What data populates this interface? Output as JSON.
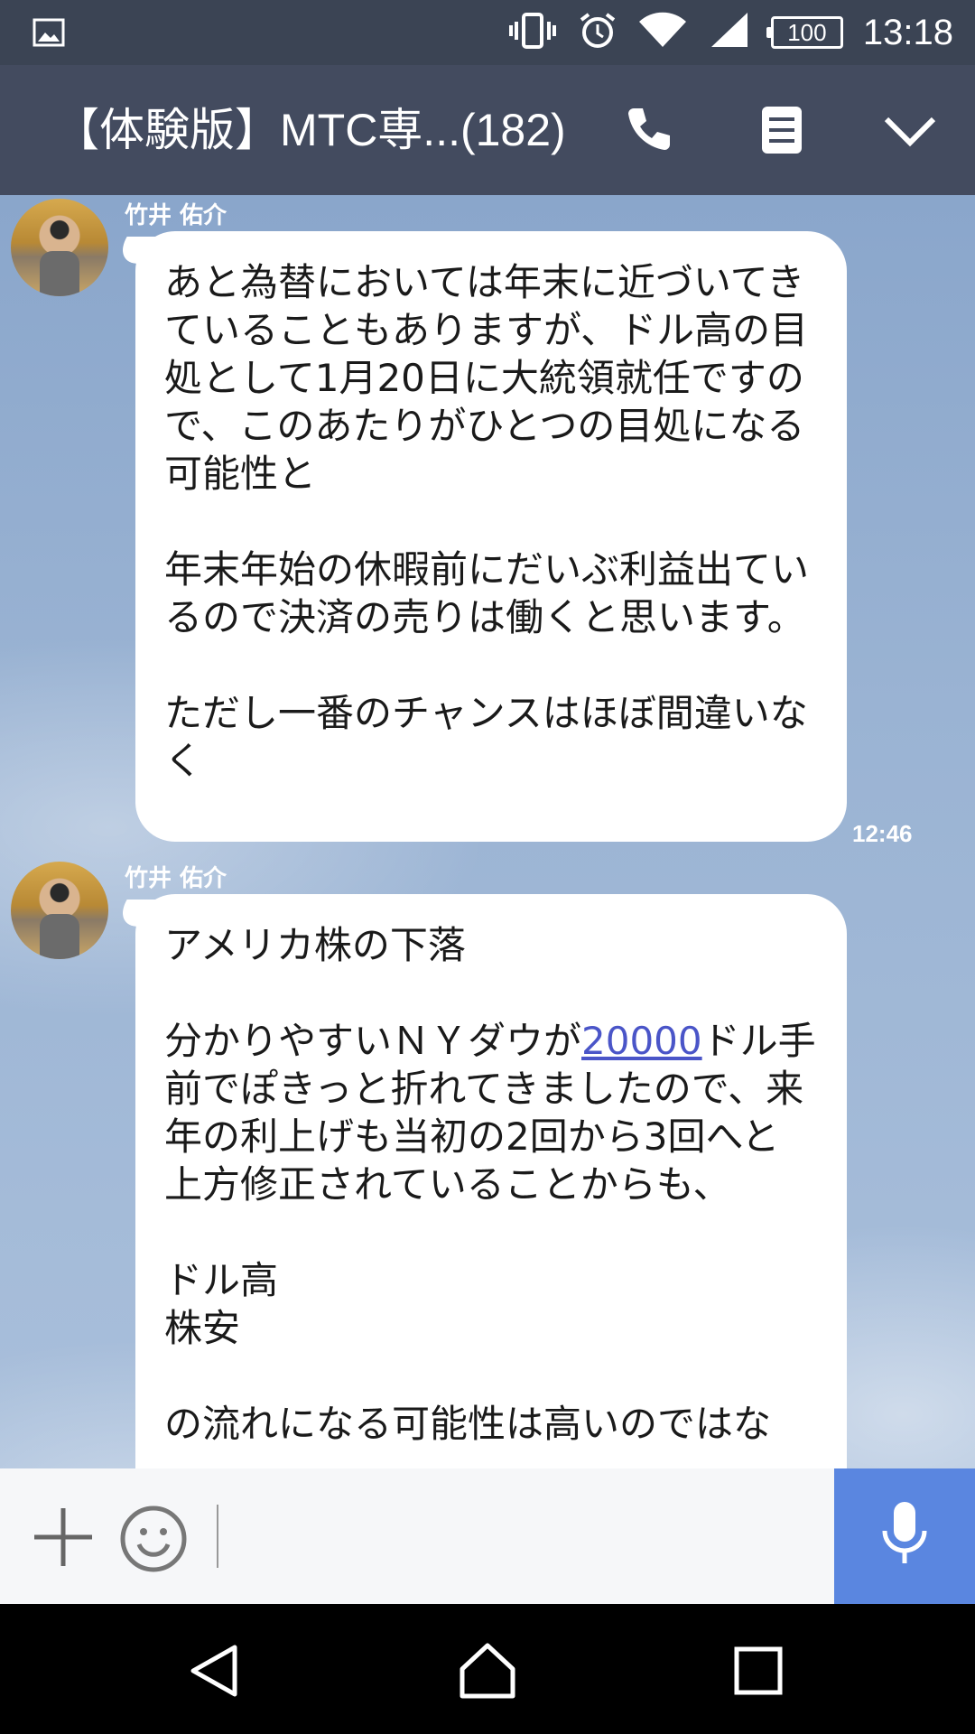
{
  "status_bar": {
    "battery": "100",
    "time": "13:18"
  },
  "header": {
    "title": "【体験版】MTC専...(182)",
    "icons": [
      "phone-icon",
      "notes-icon",
      "chevron-down-icon"
    ]
  },
  "messages": [
    {
      "sender": "竹井 佑介",
      "text": "あと為替においては年末に近づいてきていることもありますが、ドル高の目処として1月20日に大統領就任ですので、このあたりがひとつの目処になる可能性と\n\n年末年始の休暇前にだいぶ利益出ているので決済の売りは働くと思います。\n\nただし一番のチャンスはほぼ間違いなく",
      "time": "12:46"
    },
    {
      "sender": "竹井 佑介",
      "text_before_link": "アメリカ株の下落\n\n分かりやすいＮＹダウが",
      "link": "20000",
      "text_after_link": "ドル手前でぽきっと折れてきましたので、来年の利上げも当初の2回から3回へと上方修正されていることからも、\n\nドル高\n株安\n\nの流れになる可能性は高いのではな"
    }
  ],
  "input_bar": {
    "icons": [
      "plus-icon",
      "smile-icon",
      "mic-icon"
    ],
    "accent": "#5a86e0"
  },
  "nav_bar": {
    "icons": [
      "back-icon",
      "home-icon",
      "recents-icon"
    ]
  },
  "colors": {
    "header_bg": "#434b5f",
    "status_bg": "#3b4454",
    "link": "#4a55c8"
  }
}
